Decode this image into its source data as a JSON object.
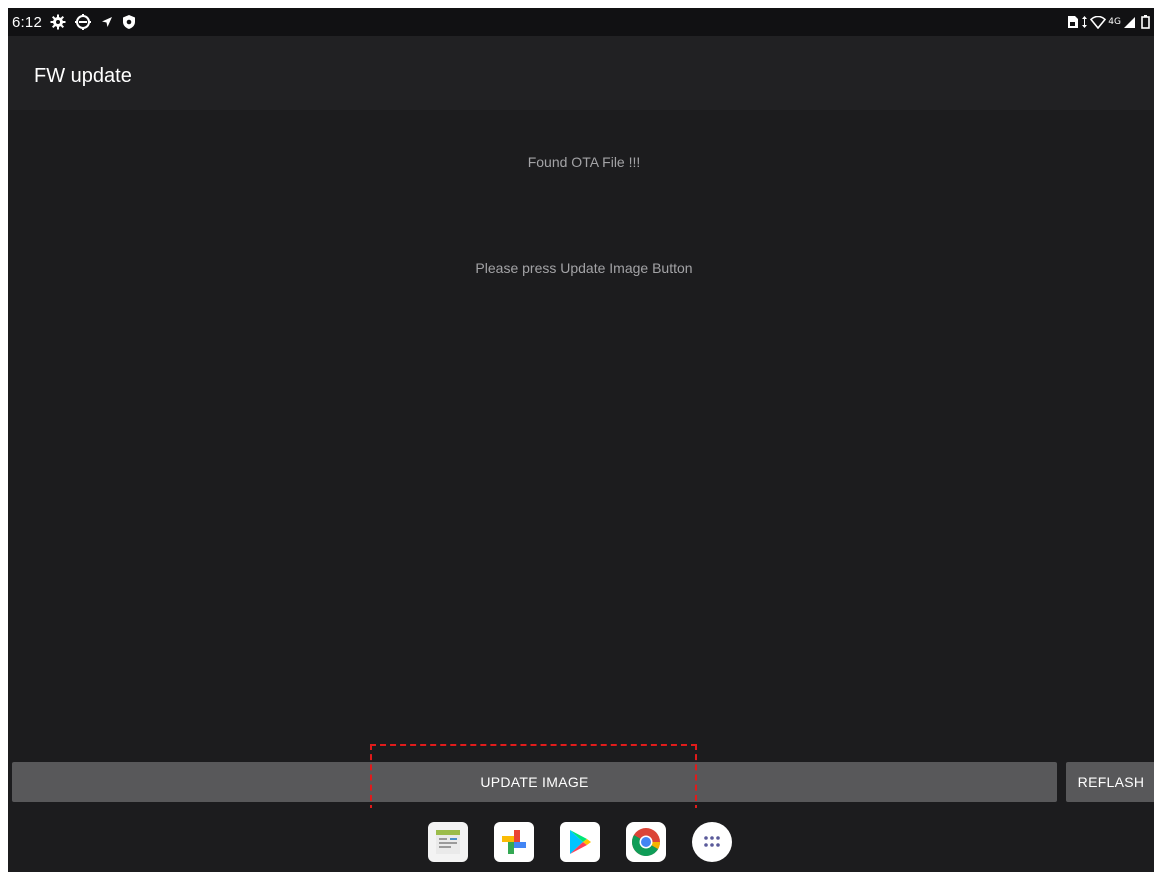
{
  "status_bar": {
    "time": "6:12",
    "left_icons": [
      "settings-gear-icon",
      "sync-gear-icon",
      "location-arrow-icon",
      "shield-icon"
    ],
    "network_label": "4G",
    "right_icons": [
      "sim-card-icon",
      "data-arrows-icon",
      "wifi-icon",
      "cell-signal-icon",
      "battery-icon"
    ]
  },
  "app_bar": {
    "title": "FW update"
  },
  "content": {
    "found_message": "Found OTA File !!!",
    "instruction_message": "Please press Update Image Button"
  },
  "buttons": {
    "update_label": "UPDATE IMAGE",
    "reflash_label": "REFLASH"
  },
  "dock": {
    "apps": [
      "sheets-app-icon",
      "photos-app-icon",
      "play-store-icon",
      "chrome-icon",
      "all-apps-icon"
    ]
  },
  "colors": {
    "background": "#1c1c1e",
    "button": "#58585a",
    "highlight": "#e01b1b",
    "muted_text": "#a3a3a6"
  }
}
